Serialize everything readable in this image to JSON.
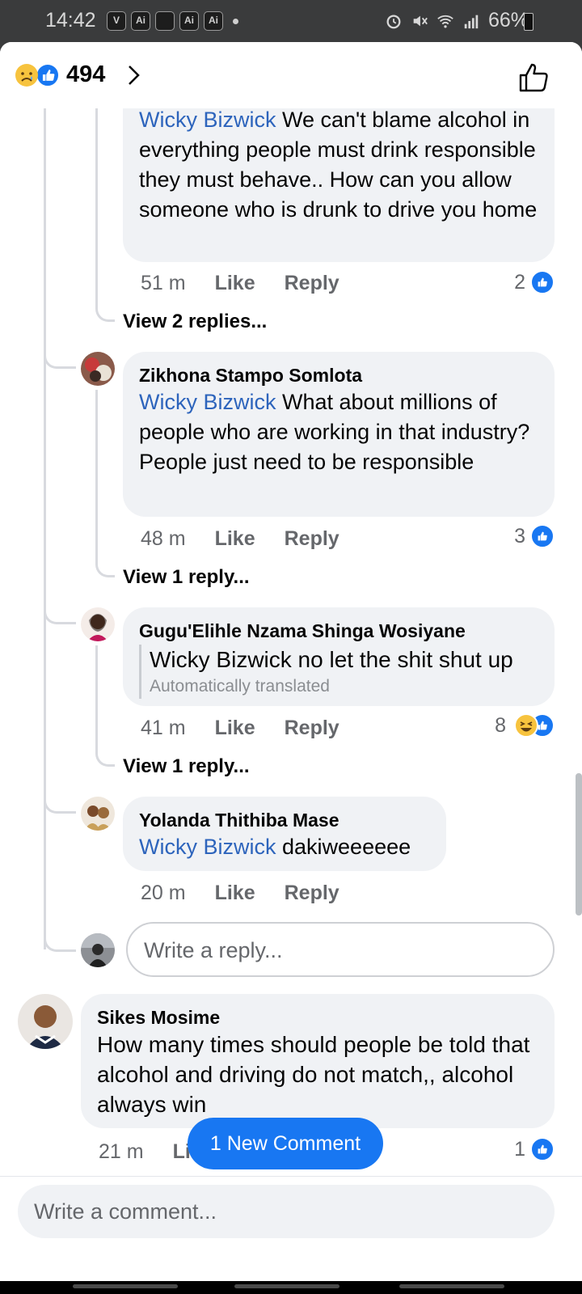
{
  "status_bar": {
    "time": "14:42",
    "app_icons": [
      "V",
      "Ai",
      "",
      "Ai",
      "Ai"
    ],
    "battery": "66%"
  },
  "header": {
    "reaction_count": "494"
  },
  "comments": [
    {
      "mention": "Wicky Bizwick",
      "text": " We can't blame alcohol in everything people must drink responsible they must behave.. How can you allow someone who is drunk to drive you home",
      "time": "51 m",
      "like": "Like",
      "reply": "Reply",
      "reactions": "2",
      "view_replies": "View 2 replies..."
    },
    {
      "author": "Zikhona Stampo Somlota",
      "mention": "Wicky Bizwick",
      "text": " What about millions of people who are working in that industry? People just need to be responsible",
      "time": "48 m",
      "like": "Like",
      "reply": "Reply",
      "reactions": "3",
      "view_replies": "View 1 reply..."
    },
    {
      "author": "Gugu'Elihle Nzama Shinga Wosiyane",
      "text": "Wicky Bizwick no let the shit shut up",
      "translated_note": "Automatically translated",
      "time": "41 m",
      "like": "Like",
      "reply": "Reply",
      "reactions": "8",
      "view_replies": "View 1 reply..."
    },
    {
      "author": "Yolanda Thithiba Mase",
      "mention": "Wicky Bizwick",
      "text": " dakiweeeeee",
      "time": "20 m",
      "like": "Like",
      "reply": "Reply"
    }
  ],
  "reply_input": {
    "placeholder": "Write a reply..."
  },
  "top_comment": {
    "author": "Sikes Mosime",
    "text": "How many times should people be told that alcohol and driving do not match,, alcohol always win",
    "time": "21 m",
    "like_partial": "Li",
    "reactions": "1"
  },
  "new_comment_pill": "1 New Comment",
  "comment_input": {
    "placeholder": "Write a comment..."
  },
  "colors": {
    "accent": "#1877f2",
    "mention": "#2d64bc",
    "bubble": "#f0f2f5"
  }
}
